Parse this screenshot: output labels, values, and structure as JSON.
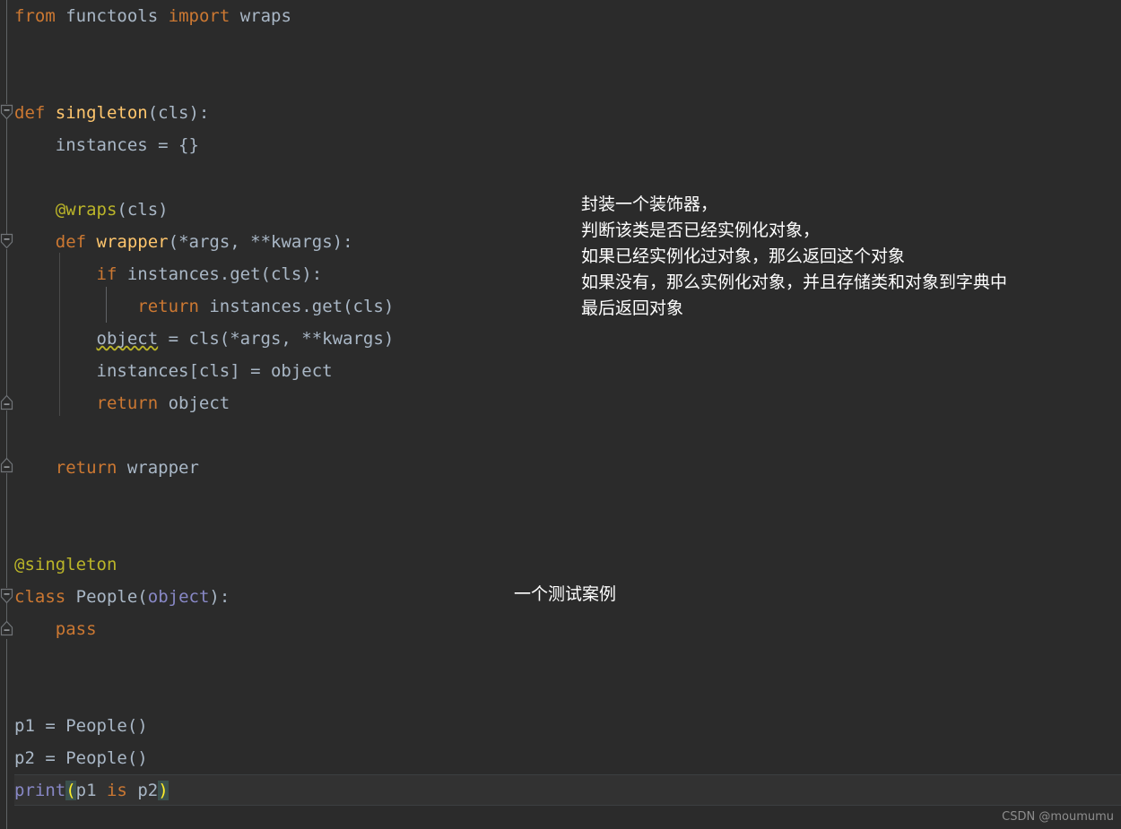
{
  "editor": {
    "theme": "darcula",
    "background_color": "#2b2b2b",
    "current_line_color": "#323232",
    "language": "python",
    "colors": {
      "keyword": "#cc7832",
      "identifier": "#a9b7c6",
      "function_name": "#ffc66d",
      "decorator": "#bbb529",
      "builtin": "#8888c6",
      "matched_brace_text": "#ffef28",
      "matched_brace_bg": "#3b514d",
      "gutter_line": "#606366",
      "indent_guide": "#4b4b4b"
    }
  },
  "code_lines": [
    {
      "n": 1,
      "tokens": [
        {
          "t": "from",
          "c": "kw"
        },
        {
          "t": " ",
          "c": "id"
        },
        {
          "t": "functools",
          "c": "id"
        },
        {
          "t": " ",
          "c": "id"
        },
        {
          "t": "import",
          "c": "kw"
        },
        {
          "t": " ",
          "c": "id"
        },
        {
          "t": "wraps",
          "c": "id"
        }
      ]
    },
    {
      "n": 2,
      "tokens": []
    },
    {
      "n": 3,
      "tokens": []
    },
    {
      "n": 4,
      "tokens": [
        {
          "t": "def",
          "c": "kw"
        },
        {
          "t": " ",
          "c": "id"
        },
        {
          "t": "singleton",
          "c": "fn"
        },
        {
          "t": "(cls):",
          "c": "id"
        }
      ]
    },
    {
      "n": 5,
      "tokens": [
        {
          "t": "    instances = {}",
          "c": "id"
        }
      ]
    },
    {
      "n": 6,
      "tokens": []
    },
    {
      "n": 7,
      "tokens": [
        {
          "t": "    ",
          "c": "id"
        },
        {
          "t": "@wraps",
          "c": "deco"
        },
        {
          "t": "(cls)",
          "c": "id"
        }
      ]
    },
    {
      "n": 8,
      "tokens": [
        {
          "t": "    ",
          "c": "id"
        },
        {
          "t": "def",
          "c": "kw"
        },
        {
          "t": " ",
          "c": "id"
        },
        {
          "t": "wrapper",
          "c": "fn"
        },
        {
          "t": "(*args, **kwargs):",
          "c": "id"
        }
      ]
    },
    {
      "n": 9,
      "tokens": [
        {
          "t": "        ",
          "c": "id"
        },
        {
          "t": "if",
          "c": "kw"
        },
        {
          "t": " instances.get(cls):",
          "c": "id"
        }
      ]
    },
    {
      "n": 10,
      "tokens": [
        {
          "t": "            ",
          "c": "id"
        },
        {
          "t": "return",
          "c": "kw"
        },
        {
          "t": " instances.get(cls)",
          "c": "id"
        }
      ]
    },
    {
      "n": 11,
      "tokens": [
        {
          "t": "        ",
          "c": "id"
        },
        {
          "t": "object",
          "c": "id warn-underline"
        },
        {
          "t": " = cls(*args, **kwargs)",
          "c": "id"
        }
      ]
    },
    {
      "n": 12,
      "tokens": [
        {
          "t": "        instances[cls] = object",
          "c": "id"
        }
      ]
    },
    {
      "n": 13,
      "tokens": [
        {
          "t": "        ",
          "c": "id"
        },
        {
          "t": "return",
          "c": "kw"
        },
        {
          "t": " object",
          "c": "id"
        }
      ]
    },
    {
      "n": 14,
      "tokens": []
    },
    {
      "n": 15,
      "tokens": [
        {
          "t": "    ",
          "c": "id"
        },
        {
          "t": "return",
          "c": "kw"
        },
        {
          "t": " wrapper",
          "c": "id"
        }
      ]
    },
    {
      "n": 16,
      "tokens": []
    },
    {
      "n": 17,
      "tokens": []
    },
    {
      "n": 18,
      "tokens": [
        {
          "t": "@singleton",
          "c": "deco"
        }
      ]
    },
    {
      "n": 19,
      "tokens": [
        {
          "t": "class",
          "c": "kw"
        },
        {
          "t": " ",
          "c": "id"
        },
        {
          "t": "People",
          "c": "cls"
        },
        {
          "t": "(",
          "c": "id"
        },
        {
          "t": "object",
          "c": "builtin"
        },
        {
          "t": "):",
          "c": "id"
        }
      ]
    },
    {
      "n": 20,
      "tokens": [
        {
          "t": "    ",
          "c": "id"
        },
        {
          "t": "pass",
          "c": "kw"
        }
      ]
    },
    {
      "n": 21,
      "tokens": []
    },
    {
      "n": 22,
      "tokens": []
    },
    {
      "n": 23,
      "tokens": [
        {
          "t": "p1 = People()",
          "c": "id"
        }
      ]
    },
    {
      "n": 24,
      "tokens": [
        {
          "t": "p2 = People()",
          "c": "id"
        }
      ]
    },
    {
      "n": 25,
      "tokens": [
        {
          "t": "print",
          "c": "builtin"
        },
        {
          "t": "(",
          "c": "match-paren"
        },
        {
          "t": "p1 ",
          "c": "id"
        },
        {
          "t": "is",
          "c": "kw"
        },
        {
          "t": " p2",
          "c": "id"
        },
        {
          "t": ")",
          "c": "match-paren"
        }
      ]
    }
  ],
  "plain_source": "from functools import wraps\n\n\ndef singleton(cls):\n    instances = {}\n\n    @wraps(cls)\n    def wrapper(*args, **kwargs):\n        if instances.get(cls):\n            return instances.get(cls)\n        object = cls(*args, **kwargs)\n        instances[cls] = object\n        return object\n\n    return wrapper\n\n\n@singleton\nclass People(object):\n    pass\n\n\np1 = People()\np2 = People()\nprint(p1 is p2)",
  "annotations": [
    {
      "id": "decorator-explanation",
      "lines": [
        "封装一个装饰器，",
        "判断该类是否已经实例化对象，",
        "如果已经实例化过对象，那么返回这个对象",
        "如果没有，那么实例化对象，并且存储类和对象到字典中",
        "最后返回对象"
      ]
    },
    {
      "id": "test-case-note",
      "lines": [
        "一个测试案例"
      ]
    }
  ],
  "fold_markers": [
    {
      "id": "fold-def-singleton",
      "state": "expanded",
      "direction": "down"
    },
    {
      "id": "fold-def-wrapper",
      "state": "expanded",
      "direction": "down"
    },
    {
      "id": "fold-end-wrapper",
      "state": "expanded",
      "direction": "up"
    },
    {
      "id": "fold-end-singleton",
      "state": "expanded",
      "direction": "up"
    },
    {
      "id": "fold-class-people",
      "state": "expanded",
      "direction": "down"
    },
    {
      "id": "fold-end-people",
      "state": "expanded",
      "direction": "up"
    }
  ],
  "watermark": {
    "text": "CSDN @moumumu"
  }
}
